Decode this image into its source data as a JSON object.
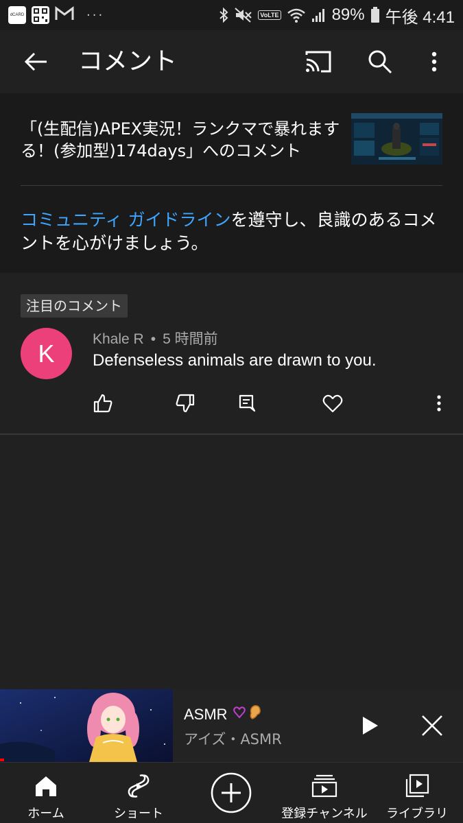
{
  "status_bar": {
    "dcard_label": "dCARD",
    "battery": "89%",
    "time": "午後 4:41",
    "volte": "VoLTE"
  },
  "app_bar": {
    "title": "コメント",
    "icons": [
      "back-arrow-icon",
      "cast-icon",
      "search-icon",
      "more-vertical-icon"
    ]
  },
  "video": {
    "title": "「(生配信)APEX実況！ランクマで暴れまする！(参加型)174days」へのコメント"
  },
  "guidelines": {
    "link_text": "コミュニティ ガイドライン",
    "rest_text": "を遵守し、良識のあるコメントを心がけましょう。"
  },
  "comment": {
    "badge": "注目のコメント",
    "avatar_letter": "K",
    "avatar_color": "#ec407a",
    "author": "Khale R",
    "separator": "•",
    "time": "5 時間前",
    "text": "Defenseless animals are drawn to you.",
    "actions": [
      "like-icon",
      "dislike-icon",
      "reply-icon",
      "heart-icon",
      "more-vertical-icon"
    ]
  },
  "mini_player": {
    "title": "ASMR",
    "emoji": "💗👂",
    "channel": "アイズ・ASMR"
  },
  "bottom_nav": {
    "items": [
      {
        "label": "ホーム",
        "icon": "home-icon"
      },
      {
        "label": "ショート",
        "icon": "shorts-icon"
      },
      {
        "label": "",
        "icon": "create-plus-icon"
      },
      {
        "label": "登録チャンネル",
        "icon": "subscriptions-icon"
      },
      {
        "label": "ライブラリ",
        "icon": "library-icon"
      }
    ]
  },
  "colors": {
    "link": "#3ea6ff",
    "background": "#212121",
    "header_bg": "#1a1a1a",
    "progress": "#ff0000"
  }
}
